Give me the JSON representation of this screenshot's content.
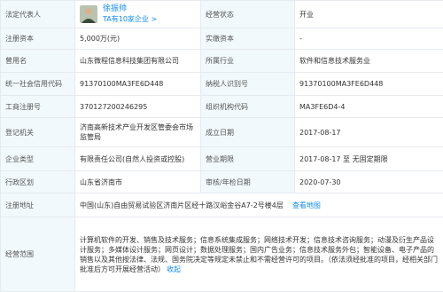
{
  "rows": {
    "legal_rep": {
      "label": "法定代表人",
      "name": "徐振帅",
      "companies": "TA有10家企业 >"
    },
    "status": {
      "label": "经营状态",
      "value": "开业"
    },
    "reg_capital": {
      "label": "注册资本",
      "value": "5,000万(元)"
    },
    "paid_capital": {
      "label": "实缴资本",
      "value": "-"
    },
    "former_name": {
      "label": "曾用名",
      "value": "山东微程信息科技集团有限公司"
    },
    "industry": {
      "label": "所属行业",
      "value": "软件和信息技术服务业"
    },
    "credit_code": {
      "label": "统一社会信用代码",
      "value": "91370100MA3FE6D448"
    },
    "taxpayer_id": {
      "label": "纳税人识别号",
      "value": "91370100MA3FE6D448"
    },
    "reg_number": {
      "label": "工商注册号",
      "value": "370127200246295"
    },
    "org_code": {
      "label": "组织机构代码",
      "value": "MA3FE6D4-4"
    },
    "authority": {
      "label": "登记机关",
      "value": "济南高新技术产业开发区管委会市场监管局"
    },
    "established": {
      "label": "成立日期",
      "value": "2017-08-17"
    },
    "company_type": {
      "label": "企业类型",
      "value": "有限责任公司(自然人投资或控股)"
    },
    "term": {
      "label": "营业期限",
      "value": "2017-08-17 至 无固定期限"
    },
    "region": {
      "label": "行政区划",
      "value": "山东省济南市"
    },
    "approval_date": {
      "label": "审核/年检日期",
      "value": "2020-07-30"
    },
    "address": {
      "label": "注册地址",
      "value": "中国(山东)自由贸易试验区济南片区经十路汉峪金谷A7-2号楼4层",
      "map_link": "查看地图"
    },
    "scope": {
      "label": "经营范围",
      "value": "计算机软件的开发、销售及技术服务；信息系统集成服务；网络技术开发；信息技术咨询服务；动漫及衍生产品设计服务；多媒体设计服务；网页设计；数据处理服务；国内广告业务；信息技术服务外包；智能设备、电子产品的销售以及其他按法律、法规、国务院决定等规定未禁止和不需经营许可的项目。（依法须经批准的项目，经相关部门批准后方可开展经营活动）",
      "collapse": "收起"
    }
  },
  "colors": {
    "label_bg": "#f2f9fc",
    "border": "#e6eaf0",
    "link": "#128bed",
    "text": "#333333",
    "label_text": "#555555"
  }
}
